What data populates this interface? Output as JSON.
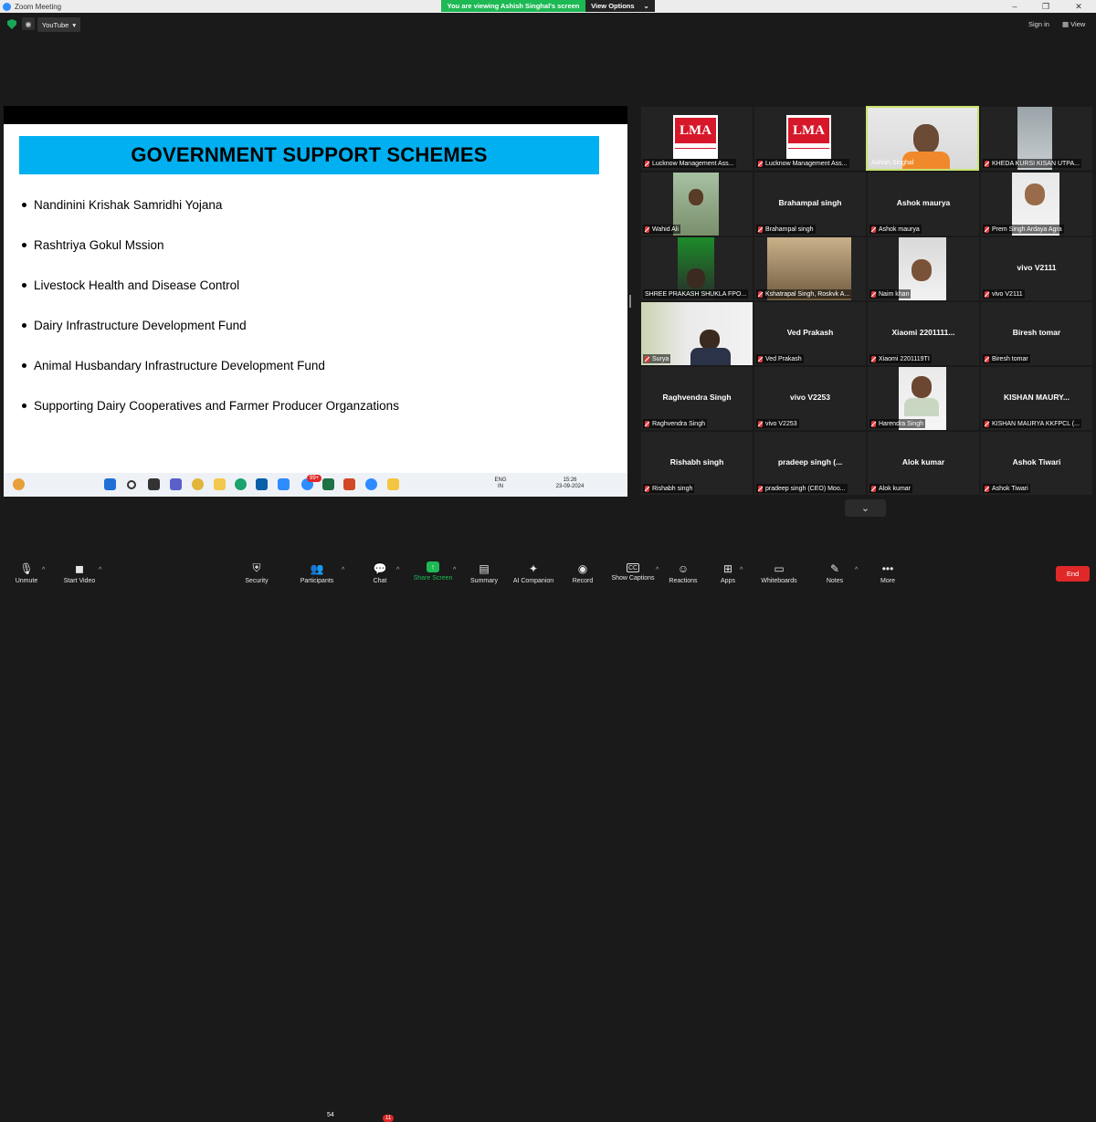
{
  "window": {
    "title": "Zoom Meeting"
  },
  "banner": {
    "text": "You are viewing Ashish Singhal's screen",
    "view_options": "View Options"
  },
  "topbar": {
    "youtube_label": "YouTube",
    "signin_label": "Sign in",
    "view_label": "View"
  },
  "slide": {
    "title": "GOVERNMENT SUPPORT SCHEMES",
    "bullets": [
      "Nandinini Krishak Samridhi Yojana",
      "Rashtriya Gokul Mssion",
      "Livestock Health and Disease Control",
      "Dairy Infrastructure Development Fund",
      "Animal Husbandary Infrastructure Development Fund",
      "Supporting Dairy Cooperatives and Farmer Producer Organzations"
    ],
    "taskbar": {
      "lang_1": "ENG",
      "lang_2": "IN",
      "time": "15:26",
      "date": "23-09-2024",
      "notify_count": "99+"
    }
  },
  "gallery": {
    "tiles": [
      {
        "caption": "Lucknow Management Ass...",
        "logo_text": "LMA"
      },
      {
        "caption": "Lucknow Management Ass...",
        "logo_text": "LMA"
      },
      {
        "caption": "Ashish Singhal"
      },
      {
        "caption": "KHEDA KURSI KISAN UTPA..."
      },
      {
        "caption": "Wahid Ali"
      },
      {
        "caption": "Brahampal singh",
        "name": "Brahampal singh"
      },
      {
        "caption": "Ashok maurya",
        "name": "Ashok maurya"
      },
      {
        "caption": "Prem Singh Ardaya Agra"
      },
      {
        "caption": "SHREE PRAKASH SHUKLA FPO..."
      },
      {
        "caption": "Kshatrapal Singh, Roskvk A..."
      },
      {
        "caption": "Naim khan"
      },
      {
        "caption": "vivo V2111",
        "name": "vivo V2111"
      },
      {
        "caption": "Surya"
      },
      {
        "caption": "Ved Prakash",
        "name": "Ved Prakash"
      },
      {
        "caption": "Xiaomi 2201119TI",
        "name": "Xiaomi 2201111..."
      },
      {
        "caption": "Biresh tomar",
        "name": "Biresh tomar"
      },
      {
        "caption": "Raghvendra Singh",
        "name": "Raghvendra Singh"
      },
      {
        "caption": "vivo V2253",
        "name": "vivo V2253"
      },
      {
        "caption": "Harendra Singh"
      },
      {
        "caption": "KISHAN MAURYA KKFPCL (...",
        "name": "KISHAN MAURY..."
      },
      {
        "caption": "Rishabh singh",
        "name": "Rishabh singh"
      },
      {
        "caption": "pradeep singh (CEO) Moo...",
        "name": "pradeep singh (..."
      },
      {
        "caption": "Alok kumar",
        "name": "Alok kumar"
      },
      {
        "caption": "Ashok Tiwari",
        "name": "Ashok Tiwari"
      }
    ]
  },
  "toolbar": {
    "unmute": "Unmute",
    "start_video": "Start Video",
    "security": "Security",
    "participants": "Participants",
    "participants_count": "54",
    "chat": "Chat",
    "chat_badge": "11",
    "share_screen": "Share Screen",
    "summary": "Summary",
    "ai_companion": "AI Companion",
    "record": "Record",
    "show_captions": "Show Captions",
    "reactions": "Reactions",
    "apps": "Apps",
    "whiteboards": "Whiteboards",
    "notes": "Notes",
    "more": "More",
    "end": "End"
  },
  "colors": {
    "share_green": "#1db954",
    "slide_title_bg": "#00b0f0",
    "end_red": "#e02828",
    "active_speaker": "#c8e26e"
  }
}
